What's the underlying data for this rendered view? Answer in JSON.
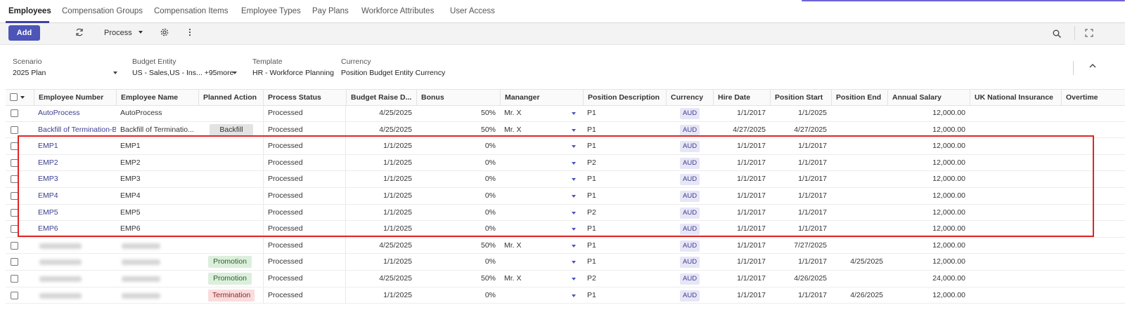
{
  "tabs": [
    {
      "label": "Employees",
      "active": true
    },
    {
      "label": "Compensation Groups",
      "active": false
    },
    {
      "label": "Compensation Items",
      "active": false
    },
    {
      "label": "Employee Types",
      "active": false
    },
    {
      "label": "Pay Plans",
      "active": false
    },
    {
      "label": "Workforce Attributes",
      "active": false
    },
    {
      "label": "User Access",
      "active": false
    }
  ],
  "toolbar": {
    "add_label": "Add",
    "process_label": "Process"
  },
  "filters": {
    "scenario": {
      "label": "Scenario",
      "value": "2025 Plan"
    },
    "budget_entity": {
      "label": "Budget Entity",
      "value": "US - Sales,US - Ins...",
      "more": "+95more"
    },
    "template": {
      "label": "Template",
      "value": "HR - Workforce Planning"
    },
    "currency": {
      "label": "Currency",
      "value": "Position Budget Entity Currency"
    }
  },
  "columns": {
    "employee_number": "Employee Number",
    "employee_name": "Employee Name",
    "planned_action": "Planned Action",
    "process_status": "Process Status",
    "budget_raise_date": "Budget Raise D...",
    "bonus": "Bonus",
    "manager": "Mananger",
    "position_description": "Position Description",
    "currency": "Currency",
    "hire_date": "Hire Date",
    "position_start": "Position Start",
    "position_end": "Position End",
    "annual_salary": "Annual Salary",
    "uk_national_insurance": "UK National Insurance",
    "overtime": "Overtime"
  },
  "rows": [
    {
      "num": "AutoProcess",
      "name": "AutoProcess",
      "action": "",
      "status": "Processed",
      "raise": "4/25/2025",
      "bonus": "50%",
      "manager": "Mr. X",
      "pos": "P1",
      "currency": "AUD",
      "hire": "1/1/2017",
      "start": "1/1/2025",
      "end": "",
      "salary": "12,000.00"
    },
    {
      "num": "Backfill of Termination-Ba",
      "name": "Backfill of Terminatio...",
      "action": "Backfill",
      "status": "Processed",
      "raise": "4/25/2025",
      "bonus": "50%",
      "manager": "Mr. X",
      "pos": "P1",
      "currency": "AUD",
      "hire": "4/27/2025",
      "start": "4/27/2025",
      "end": "",
      "salary": "12,000.00"
    },
    {
      "num": "EMP1",
      "name": "EMP1",
      "action": "",
      "status": "Processed",
      "raise": "1/1/2025",
      "bonus": "0%",
      "manager": "",
      "pos": "P1",
      "currency": "AUD",
      "hire": "1/1/2017",
      "start": "1/1/2017",
      "end": "",
      "salary": "12,000.00"
    },
    {
      "num": "EMP2",
      "name": "EMP2",
      "action": "",
      "status": "Processed",
      "raise": "1/1/2025",
      "bonus": "0%",
      "manager": "",
      "pos": "P2",
      "currency": "AUD",
      "hire": "1/1/2017",
      "start": "1/1/2017",
      "end": "",
      "salary": "12,000.00"
    },
    {
      "num": "EMP3",
      "name": "EMP3",
      "action": "",
      "status": "Processed",
      "raise": "1/1/2025",
      "bonus": "0%",
      "manager": "",
      "pos": "P1",
      "currency": "AUD",
      "hire": "1/1/2017",
      "start": "1/1/2017",
      "end": "",
      "salary": "12,000.00"
    },
    {
      "num": "EMP4",
      "name": "EMP4",
      "action": "",
      "status": "Processed",
      "raise": "1/1/2025",
      "bonus": "0%",
      "manager": "",
      "pos": "P1",
      "currency": "AUD",
      "hire": "1/1/2017",
      "start": "1/1/2017",
      "end": "",
      "salary": "12,000.00"
    },
    {
      "num": "EMP5",
      "name": "EMP5",
      "action": "",
      "status": "Processed",
      "raise": "1/1/2025",
      "bonus": "0%",
      "manager": "",
      "pos": "P2",
      "currency": "AUD",
      "hire": "1/1/2017",
      "start": "1/1/2017",
      "end": "",
      "salary": "12,000.00"
    },
    {
      "num": "EMP6",
      "name": "EMP6",
      "action": "",
      "status": "Processed",
      "raise": "1/1/2025",
      "bonus": "0%",
      "manager": "",
      "pos": "P1",
      "currency": "AUD",
      "hire": "1/1/2017",
      "start": "1/1/2017",
      "end": "",
      "salary": "12,000.00"
    },
    {
      "num": "",
      "name": "",
      "action": "",
      "status": "Processed",
      "raise": "4/25/2025",
      "bonus": "50%",
      "manager": "Mr. X",
      "pos": "P1",
      "currency": "AUD",
      "hire": "1/1/2017",
      "start": "7/27/2025",
      "end": "",
      "salary": "12,000.00"
    },
    {
      "num": "",
      "name": "",
      "action": "Promotion",
      "status": "Processed",
      "raise": "1/1/2025",
      "bonus": "0%",
      "manager": "",
      "pos": "P1",
      "currency": "AUD",
      "hire": "1/1/2017",
      "start": "1/1/2017",
      "end": "4/25/2025",
      "salary": "12,000.00"
    },
    {
      "num": "",
      "name": "",
      "action": "Promotion",
      "status": "Processed",
      "raise": "4/25/2025",
      "bonus": "50%",
      "manager": "Mr. X",
      "pos": "P2",
      "currency": "AUD",
      "hire": "1/1/2017",
      "start": "4/26/2025",
      "end": "",
      "salary": "24,000.00"
    },
    {
      "num": "",
      "name": "",
      "action": "Termination",
      "status": "Processed",
      "raise": "1/1/2025",
      "bonus": "0%",
      "manager": "",
      "pos": "P1",
      "currency": "AUD",
      "hire": "1/1/2017",
      "start": "1/1/2017",
      "end": "4/26/2025",
      "salary": "12,000.00"
    }
  ],
  "colors": {
    "accent": "#4d55b8",
    "highlight": "#e02424"
  }
}
